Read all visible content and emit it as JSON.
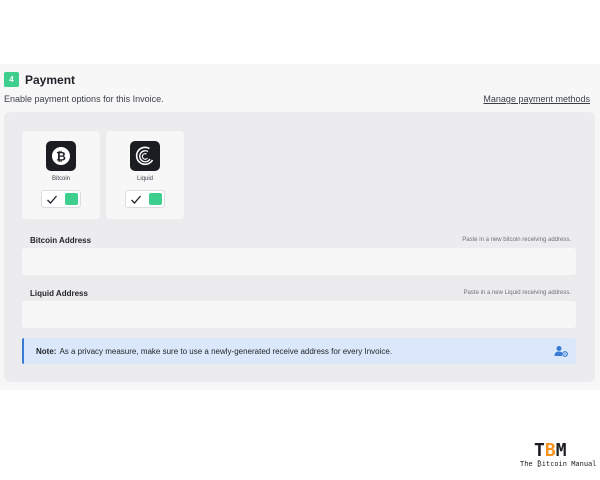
{
  "section": {
    "step_number": "4",
    "title": "Payment",
    "subtitle": "Enable payment options for this Invoice.",
    "manage_link": "Manage payment methods"
  },
  "methods": [
    {
      "name": "Bitcoin",
      "icon": "bitcoin-icon",
      "enabled": true
    },
    {
      "name": "Liquid",
      "icon": "liquid-icon",
      "enabled": true
    }
  ],
  "fields": {
    "bitcoin": {
      "label": "Bitcoin Address",
      "hint": "Paste in a new bitcoin receiving address.",
      "value": ""
    },
    "liquid": {
      "label": "Liquid Address",
      "hint": "Paste in a new Liquid receiving address.",
      "value": ""
    }
  },
  "note": {
    "prefix": "Note:",
    "text": "As a privacy measure, make sure to use a newly-generated receive address for every Invoice.",
    "icon": "user-settings-icon"
  },
  "brand": {
    "mark_t": "T",
    "mark_b": "B",
    "mark_m": "M",
    "tagline": "The ₿itcoin Manual"
  },
  "colors": {
    "accent_green": "#3ecf8e",
    "note_blue": "#3a7bd5",
    "bitcoin_orange": "#f7931a"
  }
}
